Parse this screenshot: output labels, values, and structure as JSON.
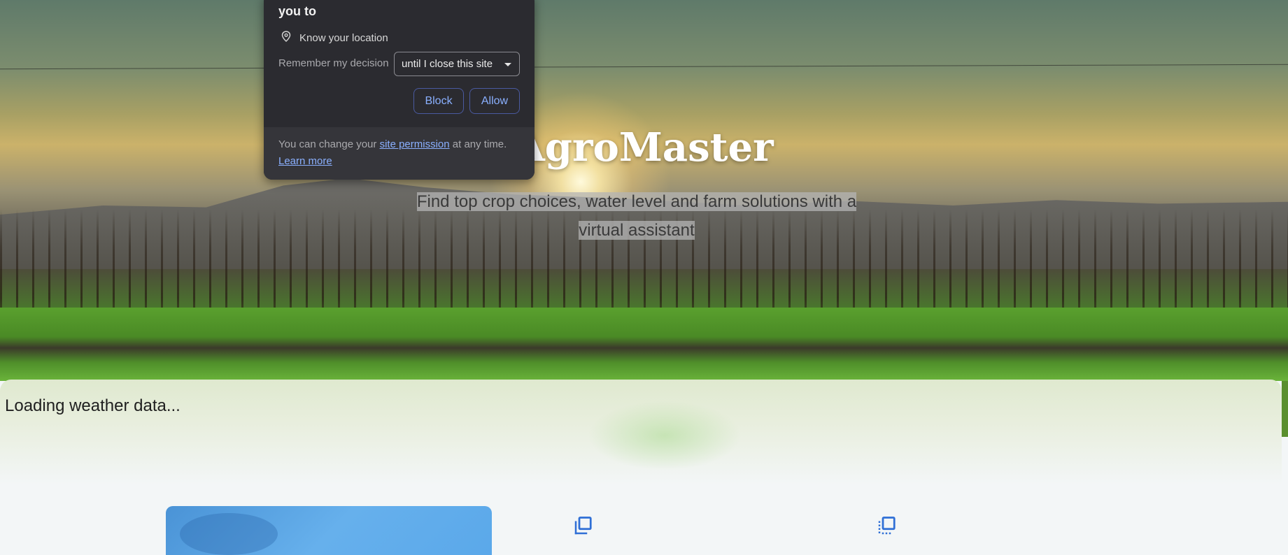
{
  "hero": {
    "title": "AgroMaster",
    "subtitle_line1": "Find top crop choices, water level and farm solutions with a",
    "subtitle_line2": "virtual assistant"
  },
  "weather": {
    "status": "Loading weather data..."
  },
  "features": {
    "icons": [
      "copy-icon",
      "dashed-copy-icon"
    ]
  },
  "permission_popup": {
    "title": "you to",
    "permission": "Know your location",
    "remember_label": "Remember my decision",
    "remember_value": "until I close this site",
    "block_label": "Block",
    "allow_label": "Allow",
    "footer_prefix": "You can change your",
    "footer_link": "site permission",
    "footer_suffix": "at any time.",
    "learn_more": "Learn more"
  },
  "colors": {
    "popup_bg": "#2b2b30",
    "link": "#8ab0ff",
    "icon_blue": "#2f6fd6"
  }
}
